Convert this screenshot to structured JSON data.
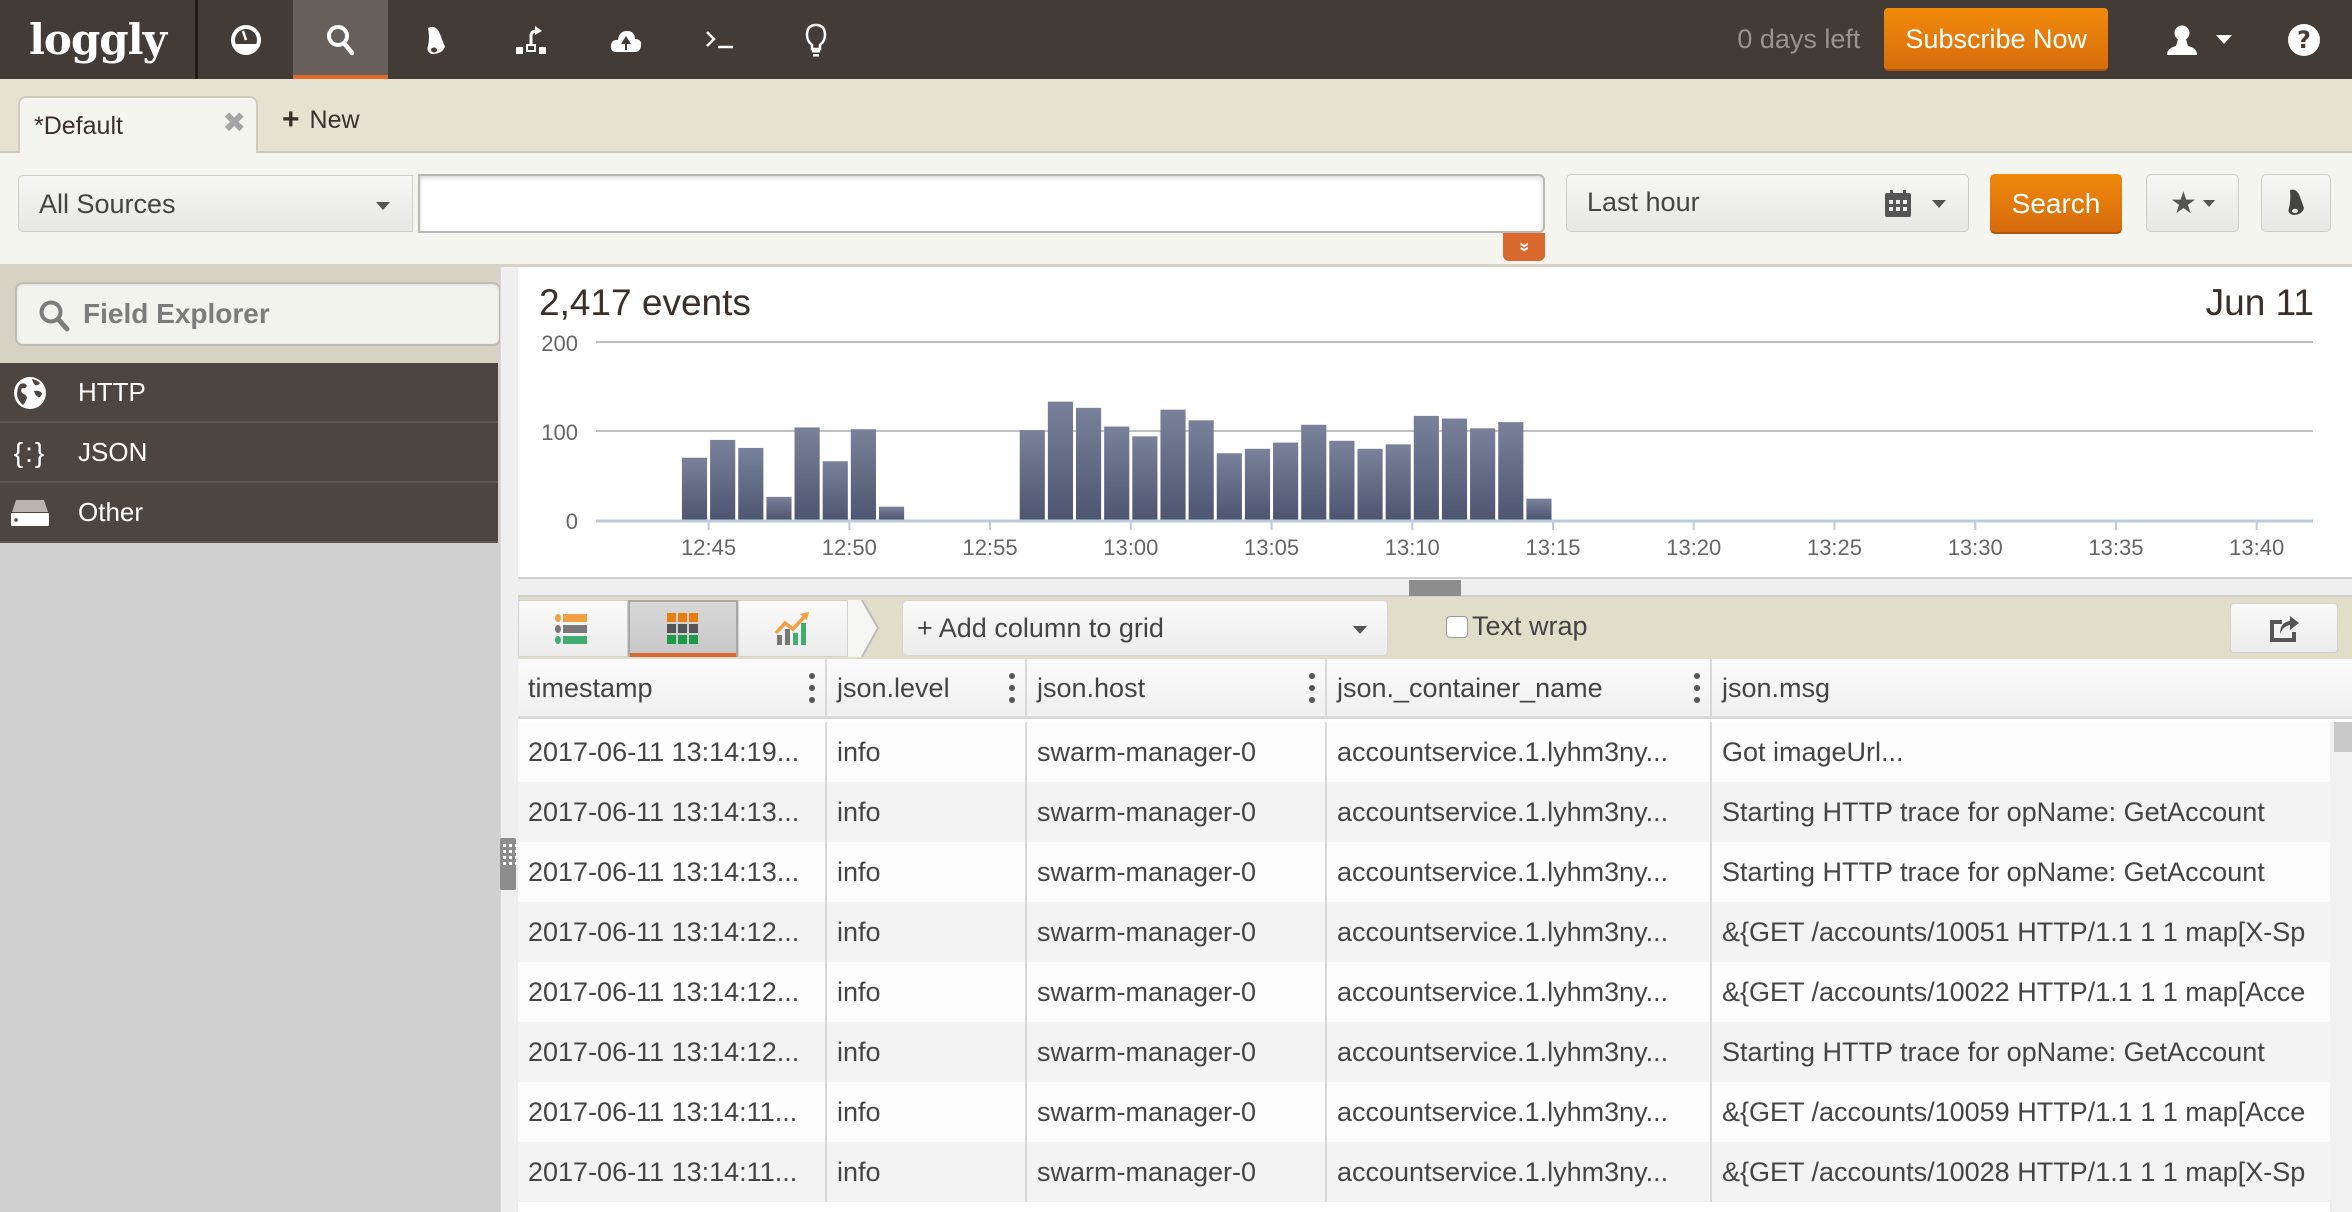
{
  "app": {
    "logo": "loggly",
    "nav_icons": [
      {
        "name": "dashboard-icon",
        "active": false
      },
      {
        "name": "search-icon",
        "active": true
      },
      {
        "name": "alerts-bell-icon",
        "active": false
      },
      {
        "name": "source-setup-icon",
        "active": false
      },
      {
        "name": "cloud-icon",
        "active": false
      },
      {
        "name": "terminal-icon",
        "active": false
      },
      {
        "name": "lightbulb-icon",
        "active": false
      }
    ],
    "days_left": "0 days left",
    "subscribe_label": "Subscribe Now",
    "user_icon": "user-icon",
    "help_icon": "help-icon"
  },
  "tabs": {
    "items": [
      {
        "label": "*Default",
        "active": true,
        "closable": true
      }
    ],
    "close_glyph": "✖",
    "new_label": "New",
    "new_glyph": "+"
  },
  "search": {
    "source_selected": "All Sources",
    "query_value": "",
    "query_placeholder": "",
    "expand_glyph": "»",
    "time_range": "Last hour",
    "search_label": "Search",
    "favorites_glyph": "★"
  },
  "sidebar": {
    "field_explorer_label": "Field Explorer",
    "items": [
      {
        "label": "HTTP",
        "icon": "globe-icon"
      },
      {
        "label": "JSON",
        "icon": "json-braces-icon",
        "glyph": "{:}"
      },
      {
        "label": "Other",
        "icon": "drive-icon"
      }
    ]
  },
  "chart_data": {
    "type": "bar",
    "title": "2,417 events",
    "date_label": "Jun 11",
    "xlabel": "",
    "ylabel": "",
    "ylim": [
      0,
      200
    ],
    "yticks": [
      0,
      100,
      200
    ],
    "xlim_minutes": [
      "12:41",
      "13:42"
    ],
    "xticks": [
      "12:45",
      "12:50",
      "12:55",
      "13:00",
      "13:05",
      "13:10",
      "13:15",
      "13:20",
      "13:25",
      "13:30",
      "13:35",
      "13:40"
    ],
    "grid": true,
    "bucket": "1 minute",
    "categories": [
      "12:44",
      "12:45",
      "12:46",
      "12:47",
      "12:48",
      "12:49",
      "12:50",
      "12:51",
      "12:52",
      "12:53",
      "12:54",
      "12:55",
      "12:56",
      "12:57",
      "12:58",
      "12:59",
      "13:00",
      "13:01",
      "13:02",
      "13:03",
      "13:04",
      "13:05",
      "13:06",
      "13:07",
      "13:08",
      "13:09",
      "13:10",
      "13:11",
      "13:12",
      "13:13",
      "13:14"
    ],
    "values": [
      70,
      90,
      81,
      26,
      104,
      66,
      102,
      15,
      0,
      0,
      0,
      0,
      101,
      133,
      126,
      105,
      94,
      124,
      112,
      75,
      80,
      87,
      107,
      89,
      80,
      85,
      117,
      114,
      103,
      110,
      24
    ]
  },
  "grid_toolbar": {
    "views": [
      {
        "name": "list-view",
        "active": false
      },
      {
        "name": "grid-view",
        "active": true
      },
      {
        "name": "chart-view",
        "active": false
      }
    ],
    "add_column_label": "+ Add column to grid",
    "text_wrap_label": "Text wrap",
    "text_wrap_checked": false
  },
  "grid": {
    "columns": [
      "timestamp",
      "json.level",
      "json.host",
      "json._container_name",
      "json.msg"
    ],
    "rows": [
      [
        "2017-06-11 13:14:19...",
        "info",
        "swarm-manager-0",
        "accountservice.1.lyhm3ny...",
        "Got imageUrl..."
      ],
      [
        "2017-06-11 13:14:13...",
        "info",
        "swarm-manager-0",
        "accountservice.1.lyhm3ny...",
        "Starting HTTP trace for opName: GetAccount"
      ],
      [
        "2017-06-11 13:14:13...",
        "info",
        "swarm-manager-0",
        "accountservice.1.lyhm3ny...",
        "Starting HTTP trace for opName: GetAccount"
      ],
      [
        "2017-06-11 13:14:12...",
        "info",
        "swarm-manager-0",
        "accountservice.1.lyhm3ny...",
        "&{GET /accounts/10051 HTTP/1.1 1 1 map[X-Sp"
      ],
      [
        "2017-06-11 13:14:12...",
        "info",
        "swarm-manager-0",
        "accountservice.1.lyhm3ny...",
        "&{GET /accounts/10022 HTTP/1.1 1 1 map[Acce"
      ],
      [
        "2017-06-11 13:14:12...",
        "info",
        "swarm-manager-0",
        "accountservice.1.lyhm3ny...",
        "Starting HTTP trace for opName: GetAccount"
      ],
      [
        "2017-06-11 13:14:11...",
        "info",
        "swarm-manager-0",
        "accountservice.1.lyhm3ny...",
        "&{GET /accounts/10059 HTTP/1.1 1 1 map[Acce"
      ],
      [
        "2017-06-11 13:14:11...",
        "info",
        "swarm-manager-0",
        "accountservice.1.lyhm3ny...",
        "&{GET /accounts/10028 HTTP/1.1 1 1 map[X-Sp"
      ]
    ]
  },
  "colors": {
    "nav_bg": "#433b36",
    "accent_orange": "#e2682a",
    "button_orange": "#f08a0b",
    "bar_top": "#7a819a",
    "bar_bottom": "#4e5570",
    "sidebar_item_bg": "#4d4540"
  }
}
